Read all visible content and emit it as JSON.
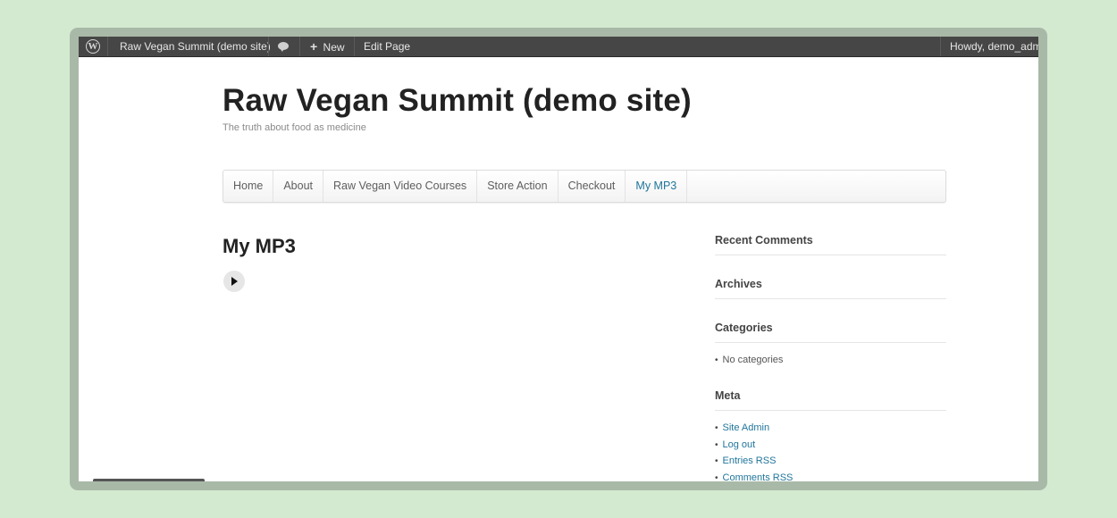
{
  "admin_bar": {
    "site_name": "Raw Vegan Summit (demo site)",
    "new_label": "New",
    "edit_label": "Edit Page",
    "howdy_label": "Howdy, demo_admin",
    "icons": {
      "logo": "wordpress-logo-icon",
      "comments": "comment-bubble-icon",
      "new": "plus-icon"
    }
  },
  "site": {
    "title": "Raw Vegan Summit (demo site)",
    "tagline": "The truth about food as medicine"
  },
  "nav": {
    "items": [
      "Home",
      "About",
      "Raw Vegan Video Courses",
      "Store Action",
      "Checkout",
      "My MP3"
    ],
    "active": "My MP3"
  },
  "page": {
    "title": "My MP3",
    "player_icon": "play-icon"
  },
  "sidebar": {
    "recent_comments_title": "Recent Comments",
    "archives_title": "Archives",
    "categories_title": "Categories",
    "categories": [
      "No categories"
    ],
    "meta_title": "Meta",
    "meta_links": [
      "Site Admin",
      "Log out",
      "Entries RSS",
      "Comments RSS"
    ]
  },
  "colors": {
    "background": "#d3ead0",
    "frame": "#a9b9a8",
    "admin_bar": "#464646",
    "link": "#21759b"
  }
}
